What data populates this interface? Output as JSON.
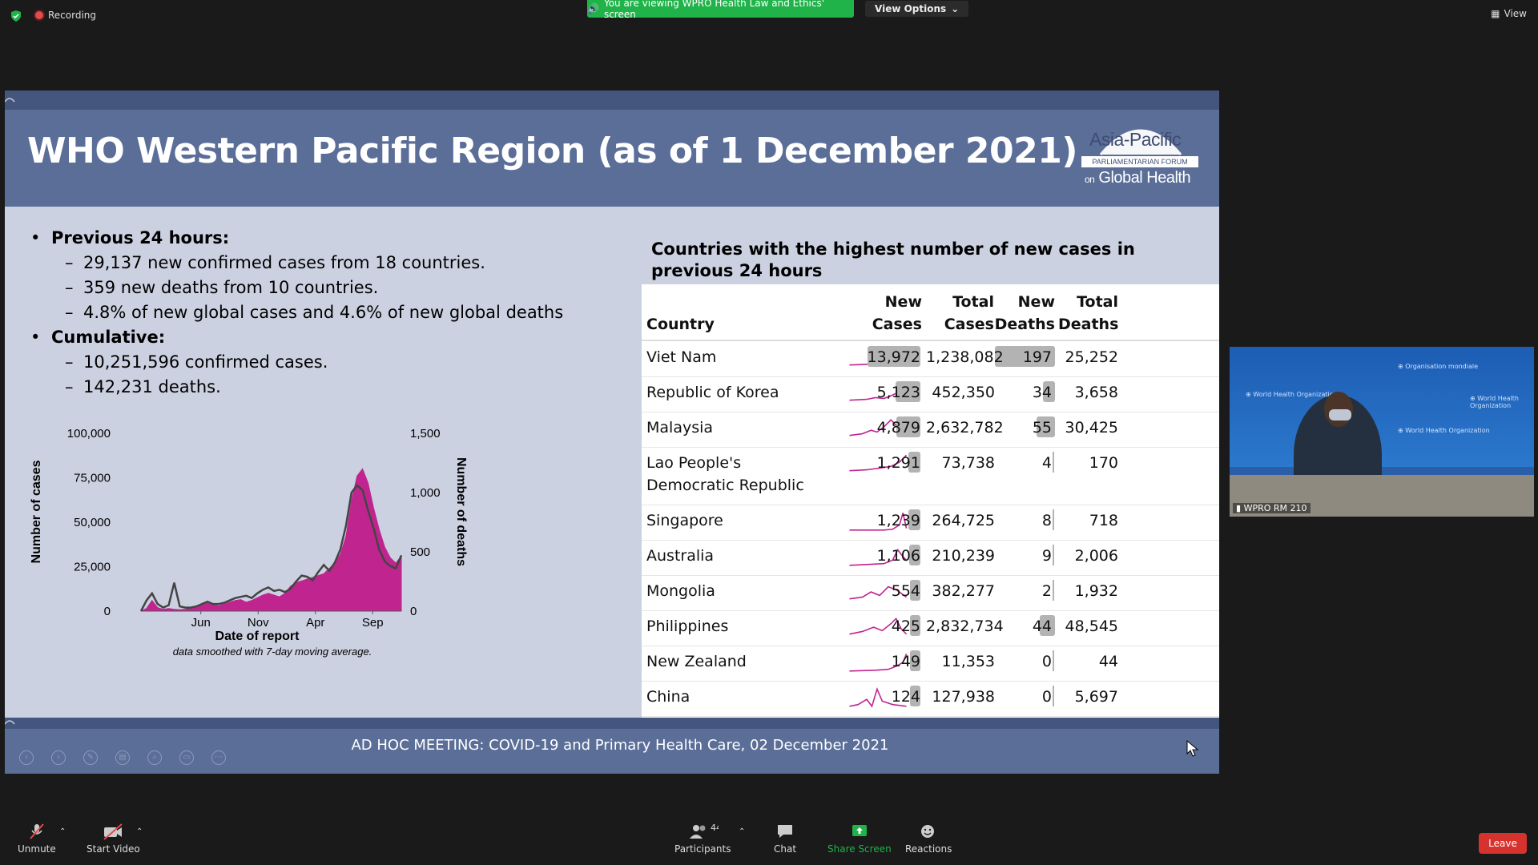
{
  "topbar": {
    "recording_label": "Recording",
    "viewing_banner": "You are viewing WPRO Health Law and Ethics' screen",
    "view_options_label": "View Options",
    "view_label": "View"
  },
  "slide": {
    "title": "WHO Western Pacific Region (as of 1 December 2021)",
    "logo": {
      "line1": "Asia-Pacific",
      "line2": "PARLIAMENTARIAN FORUM",
      "line3_on": "on",
      "line3": "Global Health"
    },
    "bullets": [
      {
        "label": "Previous 24 hours:",
        "items": [
          "29,137 new confirmed cases from 18 countries.",
          "359 new deaths from 10 countries.",
          "4.8% of new global cases and 4.6% of new global deaths"
        ]
      },
      {
        "label": "Cumulative:",
        "items": [
          "10,251,596 confirmed cases.",
          "142,231 deaths."
        ]
      }
    ],
    "footer": "AD HOC MEETING: COVID-19 and Primary Health Care, 02 December 2021"
  },
  "chart_data": {
    "type": "area",
    "title": "",
    "xlabel": "Date of report",
    "ylabel": "Number of cases",
    "y2label": "Number of deaths",
    "note": "data smoothed with 7-day moving average.",
    "x_ticks": [
      "Jun",
      "Nov",
      "Apr",
      "Sep"
    ],
    "y_ticks": [
      "0",
      "25,000",
      "50,000",
      "75,000",
      "100,000"
    ],
    "y2_ticks": [
      "0",
      "500",
      "1,000",
      "1,500"
    ],
    "ylim": [
      0,
      100000
    ],
    "y2lim": [
      0,
      1500
    ],
    "series": [
      {
        "name": "Number of cases",
        "color": "#c0258f",
        "values": [
          0,
          1500,
          6000,
          2000,
          1000,
          1500,
          1000,
          800,
          1000,
          2000,
          3000,
          4000,
          5000,
          3500,
          3000,
          4000,
          5000,
          6000,
          6500,
          5000,
          6000,
          7500,
          9000,
          10000,
          9000,
          8000,
          10000,
          14000,
          16000,
          17000,
          18000,
          19000,
          20000,
          21000,
          24000,
          27000,
          32000,
          42000,
          62000,
          76000,
          80000,
          72000,
          58000,
          46000,
          36000,
          30000,
          27000,
          31000
        ]
      },
      {
        "name": "Number of deaths",
        "color": "#444444",
        "values": [
          0,
          90,
          150,
          60,
          30,
          50,
          240,
          40,
          30,
          30,
          40,
          60,
          80,
          60,
          60,
          70,
          90,
          110,
          120,
          130,
          110,
          150,
          180,
          200,
          170,
          180,
          160,
          190,
          250,
          300,
          290,
          260,
          330,
          390,
          340,
          410,
          520,
          720,
          1000,
          1060,
          1020,
          850,
          700,
          520,
          420,
          380,
          360,
          470
        ]
      }
    ]
  },
  "table": {
    "title": "Countries with the highest number of new cases in previous 24 hours",
    "headers": {
      "country": "Country",
      "new_cases_1": "New",
      "new_cases_2": "Cases",
      "total_cases_1": "Total",
      "total_cases_2": "Cases",
      "new_deaths_1": "New",
      "new_deaths_2": "Deaths",
      "total_deaths_1": "Total",
      "total_deaths_2": "Deaths"
    },
    "rows": [
      {
        "country": "Viet Nam",
        "new_cases": "13,972",
        "total_cases": "1,238,082",
        "new_deaths": "197",
        "total_deaths": "25,252",
        "new_cases_frac": 1.0,
        "new_deaths_frac": 1.0
      },
      {
        "country": "Republic of Korea",
        "new_cases": "5,123",
        "total_cases": "452,350",
        "new_deaths": "34",
        "total_deaths": "3,658",
        "new_cases_frac": 0.37,
        "new_deaths_frac": 0.17
      },
      {
        "country": "Malaysia",
        "new_cases": "4,879",
        "total_cases": "2,632,782",
        "new_deaths": "55",
        "total_deaths": "30,425",
        "new_cases_frac": 0.35,
        "new_deaths_frac": 0.28
      },
      {
        "country": "Lao People's Democratic Republic",
        "new_cases": "1,291",
        "total_cases": "73,738",
        "new_deaths": "4",
        "total_deaths": "170",
        "new_cases_frac": 0.09,
        "new_deaths_frac": 0.02
      },
      {
        "country": "Singapore",
        "new_cases": "1,239",
        "total_cases": "264,725",
        "new_deaths": "8",
        "total_deaths": "718",
        "new_cases_frac": 0.09,
        "new_deaths_frac": 0.04
      },
      {
        "country": "Australia",
        "new_cases": "1,106",
        "total_cases": "210,239",
        "new_deaths": "9",
        "total_deaths": "2,006",
        "new_cases_frac": 0.08,
        "new_deaths_frac": 0.05
      },
      {
        "country": "Mongolia",
        "new_cases": "554",
        "total_cases": "382,277",
        "new_deaths": "2",
        "total_deaths": "1,932",
        "new_cases_frac": 0.04,
        "new_deaths_frac": 0.01
      },
      {
        "country": "Philippines",
        "new_cases": "425",
        "total_cases": "2,832,734",
        "new_deaths": "44",
        "total_deaths": "48,545",
        "new_cases_frac": 0.03,
        "new_deaths_frac": 0.22
      },
      {
        "country": "New Zealand",
        "new_cases": "149",
        "total_cases": "11,353",
        "new_deaths": "0",
        "total_deaths": "44",
        "new_cases_frac": 0.01,
        "new_deaths_frac": 0.0
      },
      {
        "country": "China",
        "new_cases": "124",
        "total_cases": "127,938",
        "new_deaths": "0",
        "total_deaths": "5,697",
        "new_cases_frac": 0.01,
        "new_deaths_frac": 0.0
      }
    ]
  },
  "video": {
    "name": "WPRO RM 210"
  },
  "toolbar": {
    "unmute": "Unmute",
    "start_video": "Start Video",
    "participants": "Participants",
    "participants_count": "44",
    "chat": "Chat",
    "share_screen": "Share Screen",
    "reactions": "Reactions",
    "leave": "Leave"
  },
  "colors": {
    "accent_green": "#20b34a",
    "leave_red": "#d6332e",
    "slide_header": "#5b6e98",
    "cases_magenta": "#c0258f"
  }
}
